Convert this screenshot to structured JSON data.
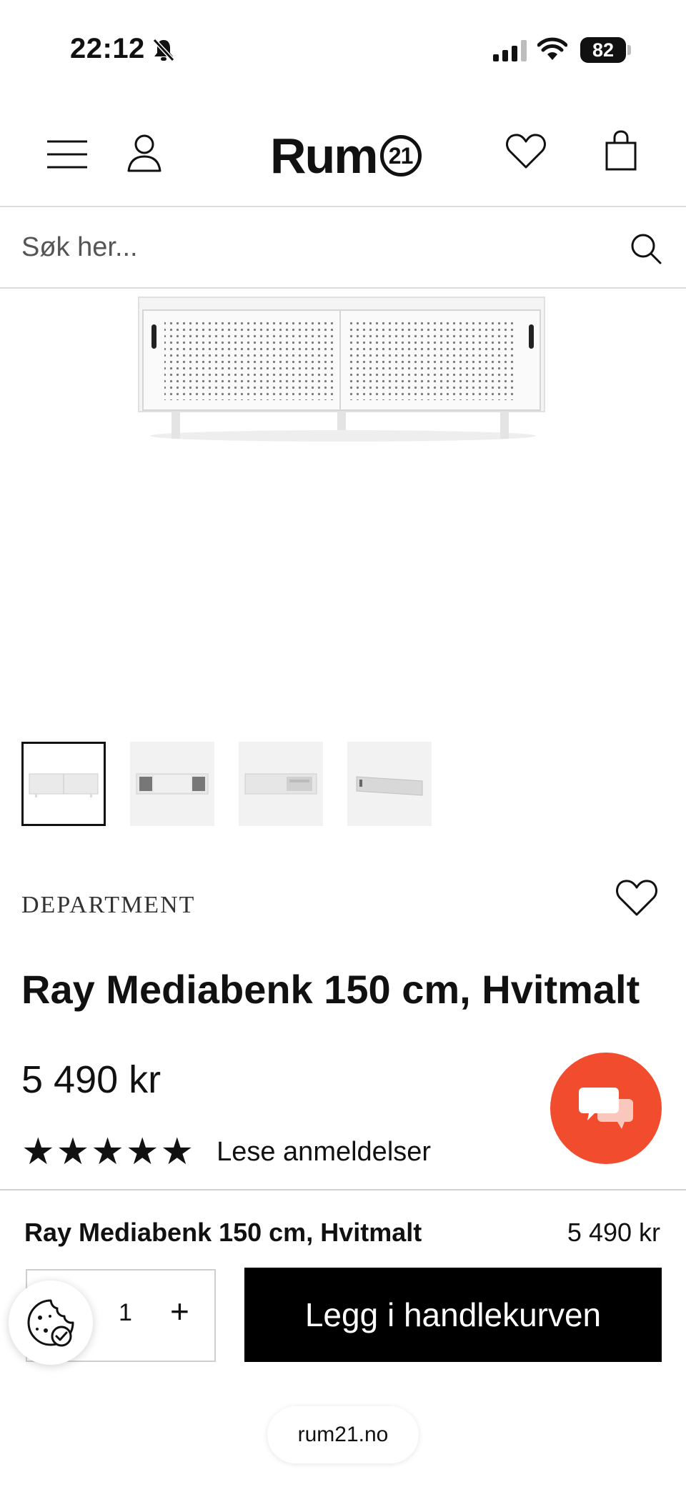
{
  "status_bar": {
    "time": "22:12",
    "battery": "82"
  },
  "header": {
    "logo_text": "Rum",
    "logo_number": "21"
  },
  "search": {
    "placeholder": "Søk her..."
  },
  "product": {
    "brand": "DEPARTMENT",
    "title": "Ray Mediabenk 150 cm, Hvitmalt",
    "price": "5 490 kr",
    "rating_stars": 5,
    "rating_display": "★★★★★",
    "rating_link": "Lese anmeldelser",
    "thumbnail_count": 4
  },
  "sticky_bar": {
    "title": "Ray Mediabenk 150 cm, Hvitmalt",
    "price": "5 490 kr",
    "quantity": "1",
    "plus_label": "+",
    "add_to_cart_label": "Legg i handlekurven"
  },
  "browser": {
    "url": "rum21.no"
  },
  "colors": {
    "accent_chat": "#f24c2e",
    "cta_background": "#000000"
  }
}
